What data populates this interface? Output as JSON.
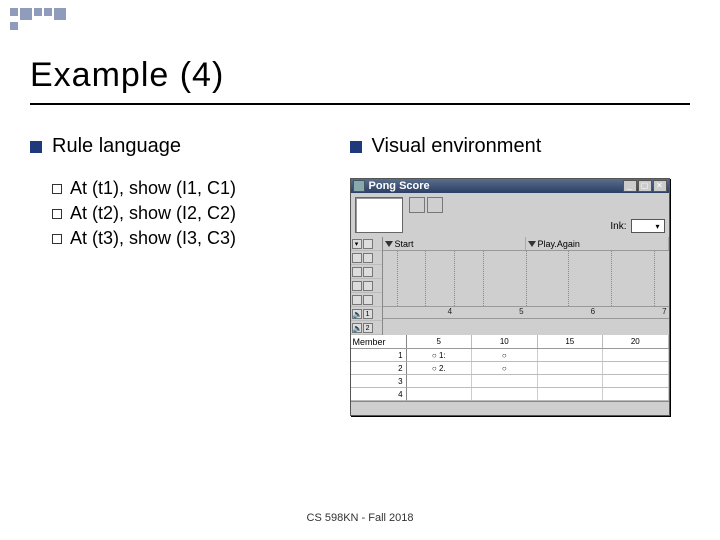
{
  "slide": {
    "title": "Example (4)",
    "footer": "CS 598KN - Fall 2018"
  },
  "left": {
    "heading": "Rule language",
    "rules": [
      "At (t1), show (I1, C1)",
      "At (t2), show (I2, C2)",
      "At (t3), show (I3, C3)"
    ]
  },
  "right": {
    "heading": "Visual environment",
    "window": {
      "title": "Pong Score",
      "toolbar": {
        "ink_label": "Ink:"
      },
      "tracks": {
        "start": "Start",
        "play_again": "Play.Again"
      },
      "timeline_ticks": [
        "5",
        "10",
        "15",
        "20"
      ],
      "member_label": "Member",
      "member_cells": [
        "5",
        "10",
        "15",
        "20"
      ],
      "gutter_numbers": [
        "1",
        "2"
      ],
      "axis_labels": [
        "4",
        "5",
        "6",
        "7"
      ],
      "row_numbers": [
        "1",
        "2",
        "3",
        "4"
      ],
      "cell_markers": {
        "r1c1": "○ 1:",
        "r1c2": "○",
        "r2c1": "○ 2.",
        "r2c2": "○"
      }
    }
  }
}
